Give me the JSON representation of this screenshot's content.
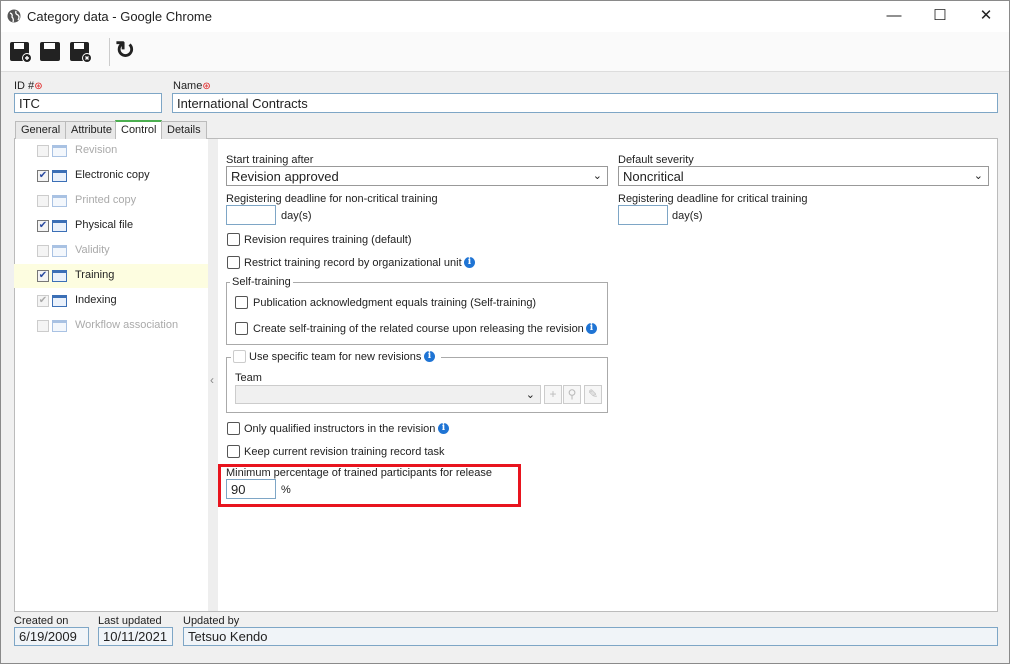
{
  "window": {
    "title": "Category data - Google Chrome",
    "minimize": "—",
    "maximize": "☐",
    "close": "✕"
  },
  "toolbar": {
    "icons": [
      "save-new-icon",
      "save-icon",
      "save-close-icon",
      "refresh-icon"
    ],
    "refresh_glyph": "↻"
  },
  "header": {
    "id_label": "ID #",
    "id_value": "ITC",
    "name_label": "Name",
    "name_value": "International Contracts",
    "required": "⊛"
  },
  "tabs": [
    "General",
    "Attribute",
    "Control",
    "Details"
  ],
  "active_tab": "Control",
  "sidebar": {
    "items": [
      {
        "label": "Revision",
        "checked": false,
        "enabled": false
      },
      {
        "label": "Electronic copy",
        "checked": true,
        "enabled": true
      },
      {
        "label": "Printed copy",
        "checked": false,
        "enabled": false
      },
      {
        "label": "Physical file",
        "checked": true,
        "enabled": true
      },
      {
        "label": "Validity",
        "checked": false,
        "enabled": false
      },
      {
        "label": "Training",
        "checked": true,
        "enabled": true,
        "selected": true
      },
      {
        "label": "Indexing",
        "checked": true,
        "enabled": true
      },
      {
        "label": "Workflow association",
        "checked": false,
        "enabled": false
      }
    ],
    "collapse_glyph": "‹"
  },
  "form": {
    "start_training_label": "Start training after",
    "start_training_value": "Revision approved",
    "default_severity_label": "Default severity",
    "default_severity_value": "Noncritical",
    "noncritical_deadline_label": "Registering deadline for non-critical training",
    "noncritical_deadline_value": "",
    "days_unit": "day(s)",
    "critical_deadline_label": "Registering deadline for critical training",
    "critical_deadline_value": "",
    "revision_requires_training": "Revision requires training (default)",
    "restrict_training_record": "Restrict training record by organizational unit",
    "self_training_legend": "Self-training",
    "publication_ack": "Publication acknowledgment equals training (Self-training)",
    "create_self_training": "Create self-training of the related course upon releasing the revision",
    "use_specific_team": "Use specific team for new revisions",
    "team_label": "Team",
    "team_value": "",
    "only_qualified": "Only qualified instructors in the revision",
    "keep_current": "Keep current revision training record task",
    "min_percentage_label": "Minimum percentage of trained participants for release",
    "min_percentage_value": "90",
    "percent_unit": "%"
  },
  "footer": {
    "created_label": "Created on",
    "created_value": "6/19/2009",
    "updated_label": "Last updated",
    "updated_value": "10/11/2021",
    "updated_by_label": "Updated by",
    "updated_by_value": "Tetsuo Kendo"
  },
  "highlight_color": "#e8141e"
}
